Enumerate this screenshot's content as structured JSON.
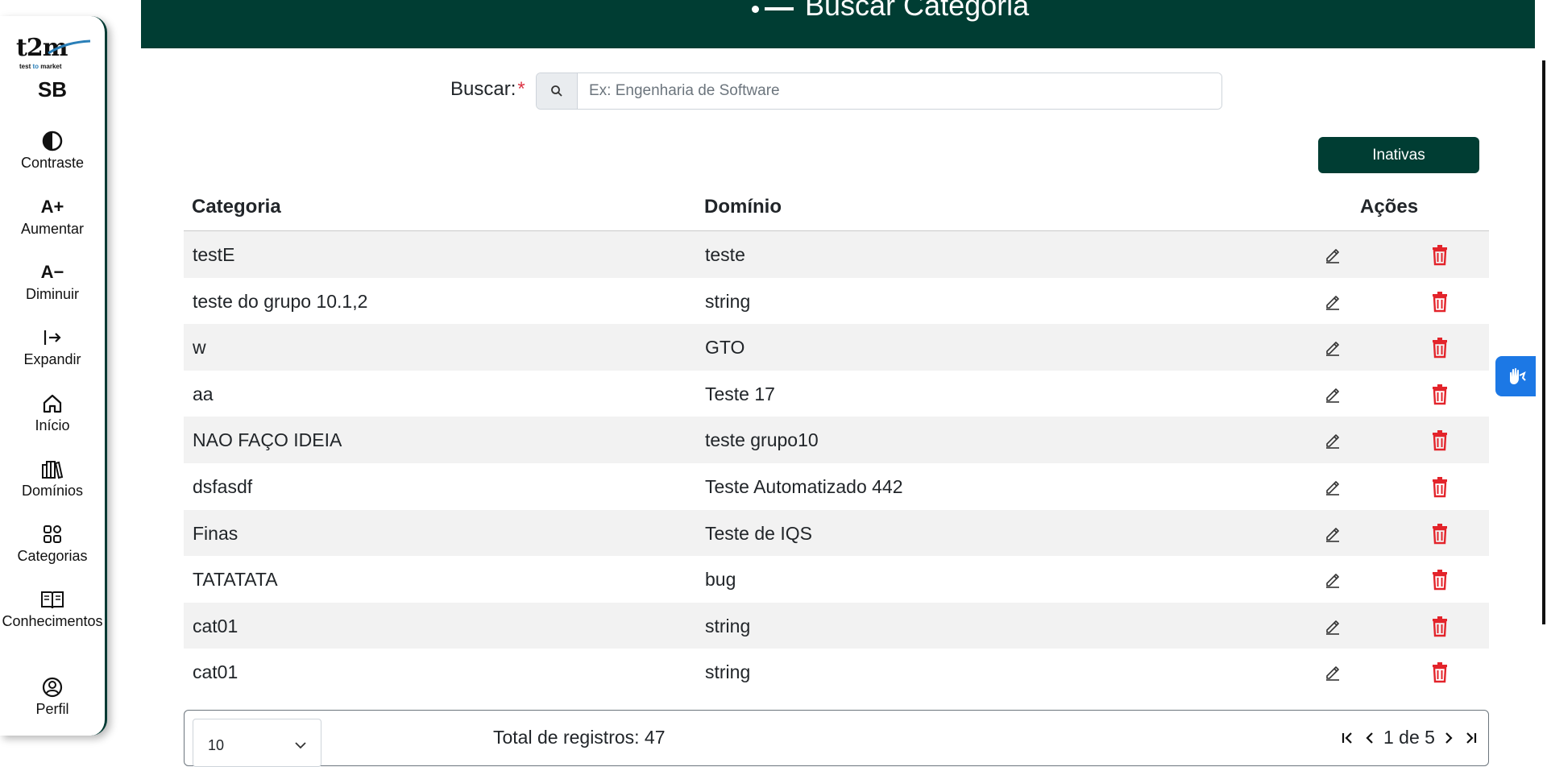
{
  "sidebar": {
    "logo_word": "t2m",
    "logo_sub_prefix": "test",
    "logo_sub_accent": "to",
    "logo_sub_suffix": "market",
    "user_initials": "SB",
    "items": [
      {
        "label": "Contraste",
        "icon": "contrast-icon"
      },
      {
        "label": "Aumentar",
        "icon": "font-increase-icon",
        "glyph": "A+"
      },
      {
        "label": "Diminuir",
        "icon": "font-decrease-icon",
        "glyph": "A−"
      },
      {
        "label": "Expandir",
        "icon": "expand-icon"
      },
      {
        "label": "Início",
        "icon": "home-icon"
      },
      {
        "label": "Domínios",
        "icon": "books-icon"
      },
      {
        "label": "Categorias",
        "icon": "grid-icon"
      },
      {
        "label": "Conhecimentos",
        "icon": "book-icon"
      },
      {
        "label": "Perfil",
        "icon": "user-circle-icon"
      }
    ]
  },
  "header": {
    "title": "Buscar Categoria"
  },
  "search": {
    "label": "Buscar:",
    "required_mark": "*",
    "placeholder": "Ex: Engenharia de Software",
    "value": ""
  },
  "actions": {
    "inactive_button": "Inativas"
  },
  "table": {
    "headers": {
      "category": "Categoria",
      "domain": "Domínio",
      "actions": "Ações"
    },
    "rows": [
      {
        "category": "testE",
        "domain": "teste"
      },
      {
        "category": "teste do grupo 10.1,2",
        "domain": "string"
      },
      {
        "category": "w",
        "domain": "GTO"
      },
      {
        "category": "aa",
        "domain": "Teste 17"
      },
      {
        "category": "NAO FAÇO IDEIA",
        "domain": "teste grupo10"
      },
      {
        "category": "dsfasdf",
        "domain": "Teste Automatizado 442"
      },
      {
        "category": "Finas",
        "domain": "Teste de IQS"
      },
      {
        "category": "TATATATA",
        "domain": "bug"
      },
      {
        "category": "cat01",
        "domain": "string"
      },
      {
        "category": "cat01",
        "domain": "string"
      }
    ]
  },
  "footer": {
    "page_size": "10",
    "total_label": "Total de registros: 47",
    "page_indicator": "1 de 5"
  },
  "colors": {
    "brand_dark": "#003d33",
    "danger": "#e3242b",
    "vlibras": "#1c78e5"
  }
}
